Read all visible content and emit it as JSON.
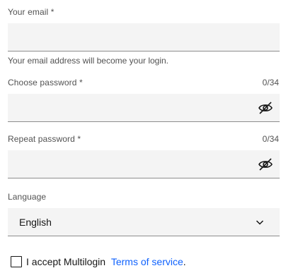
{
  "email": {
    "label": "Your email *",
    "value": "",
    "placeholder": "",
    "helper": "Your email address will become your login."
  },
  "password": {
    "label": "Choose password *",
    "counter": "0/34",
    "value": "",
    "toggle_icon": "eye-slash-icon"
  },
  "repeat_password": {
    "label": "Repeat password *",
    "counter": "0/34",
    "value": "",
    "toggle_icon": "eye-slash-icon"
  },
  "language": {
    "label": "Language",
    "selected": "English",
    "dropdown_icon": "chevron-down-icon"
  },
  "terms": {
    "accept_text": "I accept Multilogin",
    "link_text": "Terms of service",
    "suffix": ".",
    "checked": false
  },
  "colors": {
    "field_bg": "#f4f4f4",
    "link": "#0f62fe",
    "label": "#525252"
  }
}
